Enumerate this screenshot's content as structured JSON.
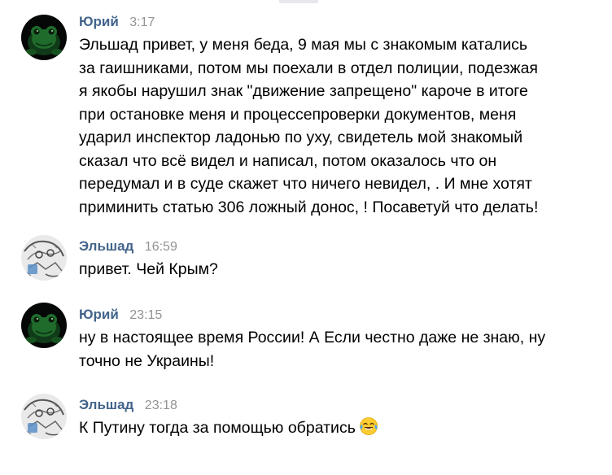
{
  "chat": {
    "messages": [
      {
        "author": "Юрий",
        "time": "3:17",
        "avatar_icon": "green-frog-avatar",
        "text": "Эльшад привет, у меня беда, 9 мая мы с знакомым катались\nза гаишниками, потом мы поехали в отдел полиции, подезжая\nя якобы нарушил знак \"движение запрещено\" кароче в итоге\nпри остановке меня и процессепроверки документов, меня\nударил инспектор ладонью по уху, свидетель мой знакомый\nсказал что всё видел и написал, потом оказалось что он\nпередумал и в суде скажет что ничего невидел, . И мне хотят\nприминить статью 306 ложный донос, ! Посаветуй что делать!"
      },
      {
        "author": "Эльшад",
        "time": "16:59",
        "avatar_icon": "sketch-avatar",
        "text": "привет. Чей Крым?"
      },
      {
        "author": "Юрий",
        "time": "23:15",
        "avatar_icon": "green-frog-avatar",
        "text": "ну в настоящее время России! А Если честно даже не знаю, ну\nточно не Украины!"
      },
      {
        "author": "Эльшад",
        "time": "23:18",
        "avatar_icon": "sketch-avatar",
        "text": "К Путину тогда за помощью обратись",
        "emoji": "tears-of-joy-emoji"
      }
    ]
  },
  "colors": {
    "author": "#42648b",
    "time": "#939393",
    "text": "#000000",
    "frog_green": "#1f6b2c"
  }
}
